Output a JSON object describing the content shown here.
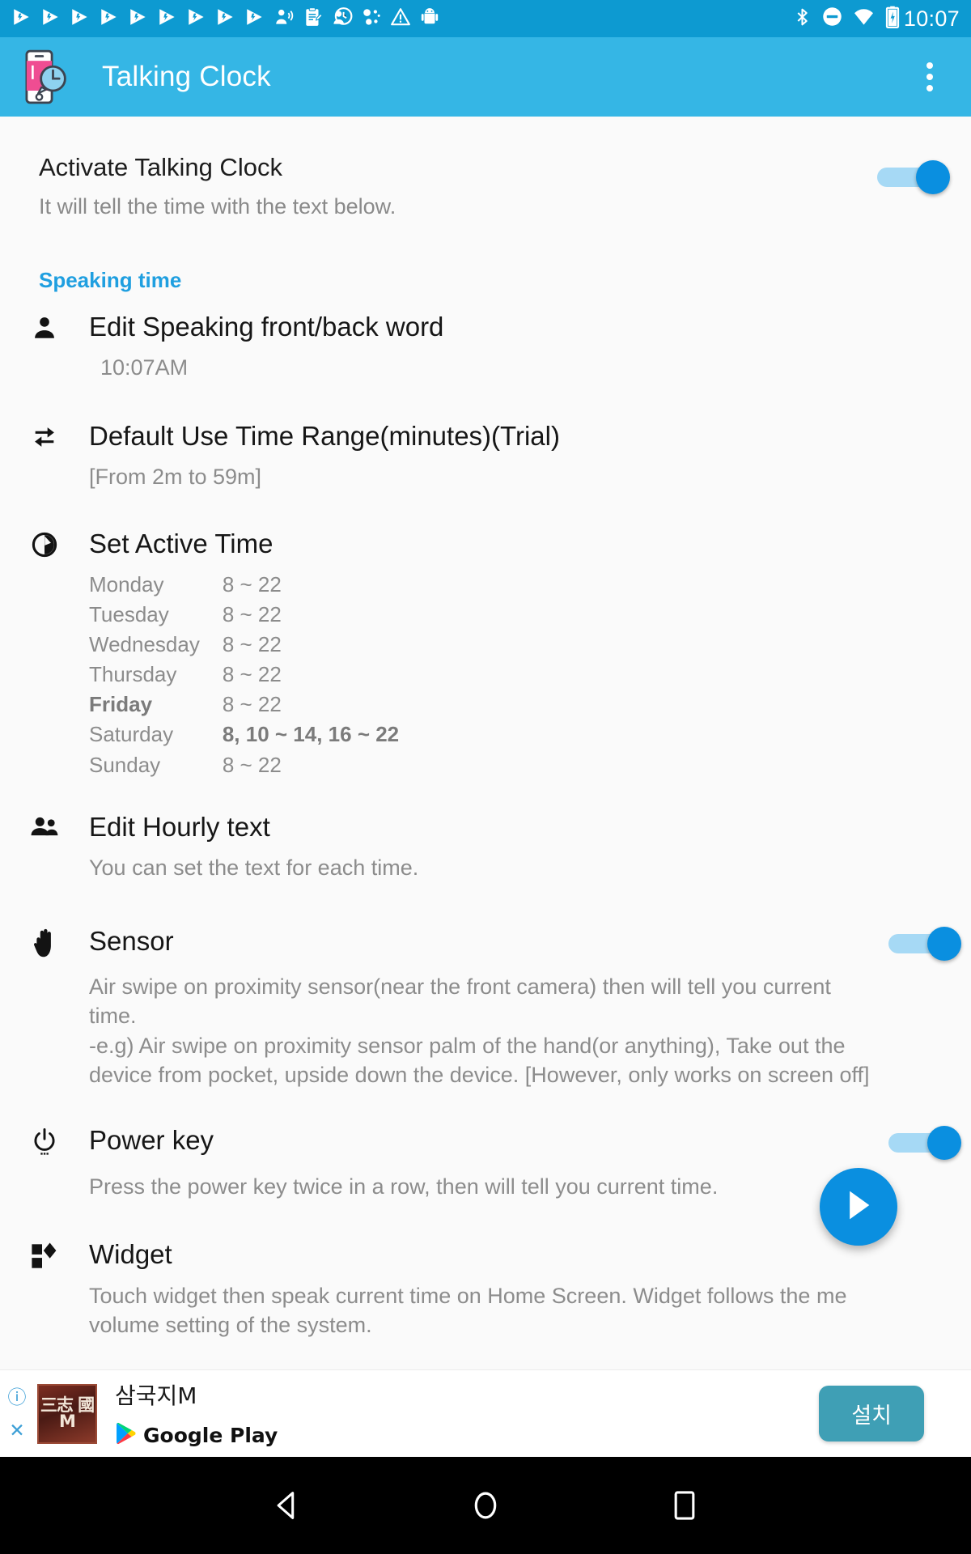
{
  "status_bar": {
    "time": "10:07",
    "left_icons": [
      "play-notification-icon",
      "play-notification-icon",
      "play-notification-icon",
      "play-notification-icon",
      "play-notification-icon",
      "play-notification-icon",
      "play-notification-icon",
      "play-notification-icon",
      "play-notification-icon",
      "voice-assistant-icon",
      "clipboard-edit-icon",
      "person-clock-icon",
      "bubbles-icon",
      "warning-icon",
      "android-robot-icon"
    ],
    "right_icons": [
      "bluetooth-icon",
      "do-not-disturb-icon",
      "wifi-icon",
      "battery-charging-icon"
    ],
    "background": "#0d9ad1"
  },
  "app_bar": {
    "title": "Talking Clock",
    "icon": "talking-clock-app-icon",
    "overflow_label": "More options",
    "background": "#35b6e5"
  },
  "activate": {
    "title": "Activate Talking Clock",
    "subtitle": "It will tell the time with the text below.",
    "switch_on": true
  },
  "section": {
    "speaking_time_label": "Speaking time",
    "accent_color": "#1f9fe0"
  },
  "prefs": {
    "edit_words": {
      "icon": "person-icon",
      "title": "Edit Speaking front/back word",
      "desc": "10:07AM"
    },
    "time_range": {
      "icon": "repeat-icon",
      "title": "Default Use Time Range(minutes)(Trial)",
      "desc": "[From 2m to 59m]"
    },
    "active_time": {
      "icon": "half-circle-icon",
      "title": "Set Active Time",
      "rows": [
        {
          "day": "Monday",
          "value": "8 ~ 22",
          "day_bold": false,
          "value_bold": false
        },
        {
          "day": "Tuesday",
          "value": "8 ~ 22",
          "day_bold": false,
          "value_bold": false
        },
        {
          "day": "Wednesday",
          "value": "8 ~ 22",
          "day_bold": false,
          "value_bold": false
        },
        {
          "day": "Thursday",
          "value": "8 ~ 22",
          "day_bold": false,
          "value_bold": false
        },
        {
          "day": "Friday",
          "value": "8 ~ 22",
          "day_bold": true,
          "value_bold": false
        },
        {
          "day": "Saturday",
          "value": "8,  10 ~ 14,  16 ~ 22",
          "day_bold": false,
          "value_bold": true
        },
        {
          "day": "Sunday",
          "value": "8 ~ 22",
          "day_bold": false,
          "value_bold": false
        }
      ]
    },
    "hourly_text": {
      "icon": "people-icon",
      "title": "Edit Hourly text",
      "desc": "You can set the text for each time."
    },
    "sensor": {
      "icon": "hand-icon",
      "title": "Sensor",
      "desc_line1": "Air swipe on proximity sensor(near the front camera) then will tell you current",
      "desc_line2": "time.",
      "desc_line3": "-e.g) Air swipe on proximity sensor palm of the hand(or anything), Take out the",
      "desc_line4": "device from pocket, upside down the device. [However, only works on screen off]",
      "switch_on": true
    },
    "power_key": {
      "icon": "power-icon",
      "title": "Power key",
      "desc": "Press the power key twice in a row, then will tell you current time.",
      "switch_on": true
    },
    "widget": {
      "icon": "widget-icon",
      "title": "Widget",
      "desc_line1": "Touch widget then speak current time on Home Screen. Widget follows the me",
      "desc_line2": "volume setting of the system."
    }
  },
  "fab": {
    "icon": "play-icon",
    "color": "#0a8fe0"
  },
  "ad": {
    "info_icon": "info-icon",
    "close_icon": "close-icon",
    "thumb_text": "三志\n國M",
    "title": "삼국지M",
    "store_icon": "google-play-icon",
    "store_name": "Google Play",
    "install_label": "설치",
    "install_color": "#3f9fb5"
  },
  "nav_bar": {
    "back_label": "Back",
    "home_label": "Home",
    "recents_label": "Recents"
  }
}
